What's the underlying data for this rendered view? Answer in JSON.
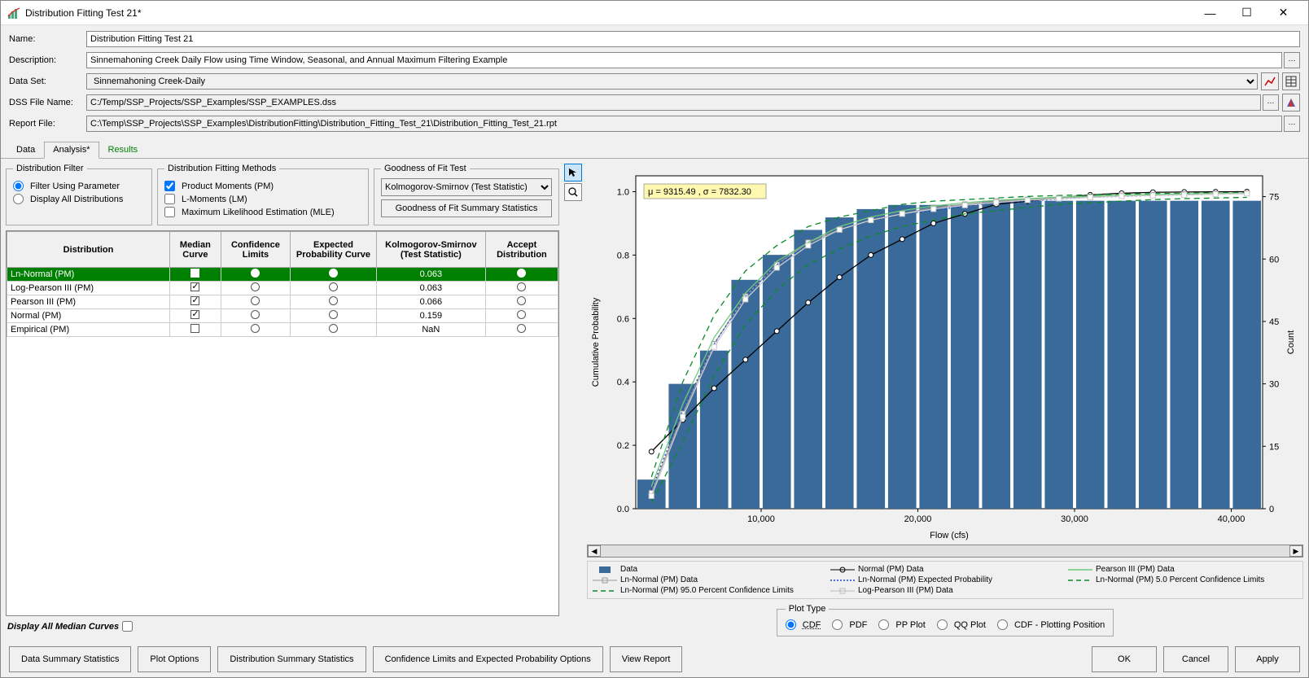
{
  "window": {
    "title": "Distribution Fitting Test 21*"
  },
  "form": {
    "name_label": "Name:",
    "name_value": "Distribution Fitting Test 21",
    "desc_label": "Description:",
    "desc_value": "Sinnemahoning Creek Daily Flow using Time Window, Seasonal, and Annual Maximum Filtering Example",
    "dataset_label": "Data Set:",
    "dataset_value": "Sinnemahoning Creek-Daily",
    "dssfile_label": "DSS File Name:",
    "dssfile_value": "C:/Temp/SSP_Projects/SSP_Examples/SSP_EXAMPLES.dss",
    "report_label": "Report File:",
    "report_value": "C:\\Temp\\SSP_Projects\\SSP_Examples\\DistributionFitting\\Distribution_Fitting_Test_21\\Distribution_Fitting_Test_21.rpt"
  },
  "tabs": {
    "data": "Data",
    "analysis": "Analysis*",
    "results": "Results"
  },
  "filter_fs": {
    "legend": "Distribution Filter",
    "opt1": "Filter Using Parameter",
    "opt2": "Display All Distributions"
  },
  "methods_fs": {
    "legend": "Distribution Fitting Methods",
    "pm": "Product Moments (PM)",
    "lm": "L-Moments (LM)",
    "mle": "Maximum Likelihood Estimation (MLE)"
  },
  "goodness_fs": {
    "legend": "Goodness of Fit Test",
    "sel": "Kolmogorov-Smirnov (Test Statistic)",
    "btn": "Goodness of Fit Summary Statistics"
  },
  "table_headers": {
    "dist": "Distribution",
    "median": "Median Curve",
    "conf": "Confidence Limits",
    "exp": "Expected Probability Curve",
    "ks": "Kolmogorov-Smirnov (Test Statistic)",
    "accept": "Accept Distribution"
  },
  "table_rows": [
    {
      "name": "Ln-Normal (PM)",
      "median": true,
      "conf_sel": true,
      "exp_sel": true,
      "ks": "0.063",
      "accept_sel": true,
      "selected": true
    },
    {
      "name": "Log-Pearson III (PM)",
      "median": true,
      "conf_sel": false,
      "exp_sel": false,
      "ks": "0.063",
      "accept_sel": false,
      "selected": false
    },
    {
      "name": "Pearson III (PM)",
      "median": true,
      "conf_sel": false,
      "exp_sel": false,
      "ks": "0.066",
      "accept_sel": false,
      "selected": false
    },
    {
      "name": "Normal (PM)",
      "median": true,
      "conf_sel": false,
      "exp_sel": false,
      "ks": "0.159",
      "accept_sel": false,
      "selected": false
    },
    {
      "name": "Empirical (PM)",
      "median": false,
      "conf_sel": false,
      "exp_sel": false,
      "ks": "NaN",
      "accept_sel": false,
      "selected": false
    }
  ],
  "display_all_median": "Display All Median Curves",
  "chart_annotation": "μ = 9315.49 , σ = 7832.30",
  "chart_data": {
    "type": "bar+line",
    "xlabel": "Flow (cfs)",
    "ylabel_left": "Cumulative Probability",
    "ylabel_right": "Count",
    "x_ticks": [
      10000,
      20000,
      30000,
      40000
    ],
    "y_left_ticks": [
      0.0,
      0.2,
      0.4,
      0.6,
      0.8,
      1.0
    ],
    "y_right_ticks": [
      0,
      15,
      30,
      45,
      60,
      75
    ],
    "xlim": [
      2000,
      42000
    ],
    "ylim_left": [
      0,
      1.05
    ],
    "ylim_right": [
      0,
      80
    ],
    "bars": {
      "categories": [
        3000,
        5000,
        7000,
        9000,
        11000,
        13000,
        15000,
        17000,
        19000,
        21000,
        23000,
        25000,
        27000,
        29000,
        31000,
        33000,
        35000,
        37000,
        39000,
        41000
      ],
      "counts": [
        7,
        30,
        38,
        55,
        61,
        67,
        70,
        72,
        73,
        73,
        73,
        74,
        74,
        74,
        74,
        74,
        74,
        74,
        74,
        74
      ]
    },
    "series": [
      {
        "name": "Normal (PM) Data",
        "style": "black-circle-line",
        "x": [
          3000,
          5000,
          7000,
          9000,
          11000,
          13000,
          15000,
          17000,
          19000,
          21000,
          23000,
          25000,
          27000,
          29000,
          31000,
          33000,
          35000,
          37000,
          39000,
          41000
        ],
        "y": [
          0.18,
          0.28,
          0.38,
          0.47,
          0.56,
          0.65,
          0.73,
          0.8,
          0.85,
          0.9,
          0.93,
          0.96,
          0.97,
          0.98,
          0.99,
          0.995,
          0.998,
          0.999,
          0.9995,
          1.0
        ]
      },
      {
        "name": "Ln-Normal (PM) Data",
        "style": "gray-square-line",
        "x": [
          3000,
          5000,
          7000,
          9000,
          11000,
          13000,
          15000,
          17000,
          19000,
          21000,
          23000,
          25000,
          27000,
          29000,
          31000,
          33000,
          35000,
          37000,
          39000,
          41000
        ],
        "y": [
          0.05,
          0.3,
          0.52,
          0.67,
          0.77,
          0.84,
          0.88,
          0.91,
          0.93,
          0.95,
          0.96,
          0.97,
          0.975,
          0.98,
          0.985,
          0.988,
          0.99,
          0.992,
          0.994,
          0.995
        ]
      },
      {
        "name": "Ln-Normal (PM) Expected Probability",
        "style": "blue-dotted",
        "x": [
          3000,
          5000,
          7000,
          9000,
          11000,
          13000,
          15000,
          17000,
          19000,
          21000,
          23000,
          25000,
          27000,
          29000,
          31000,
          33000,
          35000,
          37000,
          39000,
          41000
        ],
        "y": [
          0.06,
          0.31,
          0.52,
          0.67,
          0.77,
          0.83,
          0.88,
          0.91,
          0.93,
          0.94,
          0.955,
          0.965,
          0.97,
          0.977,
          0.982,
          0.985,
          0.988,
          0.99,
          0.992,
          0.994
        ]
      },
      {
        "name": "Ln-Normal (PM) 95.0 Percent Confidence Limits",
        "style": "green-dashed",
        "x": [
          3000,
          5000,
          7000,
          9000,
          11000,
          13000,
          15000,
          17000,
          19000,
          21000,
          23000,
          25000,
          27000,
          29000,
          31000,
          33000,
          35000,
          37000,
          39000,
          41000
        ],
        "y": [
          0.1,
          0.4,
          0.61,
          0.75,
          0.83,
          0.89,
          0.92,
          0.94,
          0.96,
          0.97,
          0.975,
          0.98,
          0.985,
          0.988,
          0.99,
          0.992,
          0.994,
          0.995,
          0.996,
          0.997
        ]
      },
      {
        "name": "Ln-Normal (PM) 5.0 Percent Confidence Limits",
        "style": "green-dashed",
        "x": [
          3000,
          5000,
          7000,
          9000,
          11000,
          13000,
          15000,
          17000,
          19000,
          21000,
          23000,
          25000,
          27000,
          29000,
          31000,
          33000,
          35000,
          37000,
          39000,
          41000
        ],
        "y": [
          0.02,
          0.21,
          0.42,
          0.58,
          0.69,
          0.77,
          0.82,
          0.86,
          0.89,
          0.91,
          0.93,
          0.94,
          0.95,
          0.96,
          0.965,
          0.97,
          0.975,
          0.978,
          0.98,
          0.982
        ]
      },
      {
        "name": "Pearson III (PM) Data",
        "style": "lightgreen-line",
        "x": [
          3000,
          5000,
          7000,
          9000,
          11000,
          13000,
          15000,
          17000,
          19000,
          21000,
          23000,
          25000,
          27000,
          29000,
          31000,
          33000,
          35000,
          37000,
          39000,
          41000
        ],
        "y": [
          0.07,
          0.33,
          0.54,
          0.68,
          0.78,
          0.84,
          0.89,
          0.92,
          0.94,
          0.955,
          0.965,
          0.973,
          0.978,
          0.983,
          0.986,
          0.989,
          0.991,
          0.993,
          0.994,
          0.995
        ]
      },
      {
        "name": "Log-Pearson III (PM) Data",
        "style": "gray-square-line2",
        "x": [
          3000,
          5000,
          7000,
          9000,
          11000,
          13000,
          15000,
          17000,
          19000,
          21000,
          23000,
          25000,
          27000,
          29000,
          31000,
          33000,
          35000,
          37000,
          39000,
          41000
        ],
        "y": [
          0.04,
          0.29,
          0.51,
          0.66,
          0.76,
          0.83,
          0.88,
          0.91,
          0.93,
          0.945,
          0.957,
          0.966,
          0.973,
          0.978,
          0.982,
          0.986,
          0.988,
          0.99,
          0.992,
          0.994
        ]
      }
    ]
  },
  "legend": {
    "data": "Data",
    "normal": "Normal (PM) Data",
    "pearson": "Pearson III (PM) Data",
    "lnnormal": "Ln-Normal (PM) Data",
    "lnnormal_exp": "Ln-Normal (PM) Expected Probability",
    "lnnormal_5": "Ln-Normal (PM) 5.0 Percent Confidence Limits",
    "lnnormal_95": "Ln-Normal (PM) 95.0 Percent Confidence Limits",
    "logpearson": "Log-Pearson III (PM) Data"
  },
  "plot_type": {
    "legend": "Plot Type",
    "cdf": "CDF",
    "pdf": "PDF",
    "pp": "PP Plot",
    "qq": "QQ Plot",
    "cdfpp": "CDF - Plotting Position"
  },
  "buttons": {
    "data_summary": "Data Summary Statistics",
    "plot_options": "Plot Options",
    "dist_summary": "Distribution Summary Statistics",
    "conf_opts": "Confidence Limits and Expected Probability Options",
    "view_report": "View Report",
    "ok": "OK",
    "cancel": "Cancel",
    "apply": "Apply"
  }
}
